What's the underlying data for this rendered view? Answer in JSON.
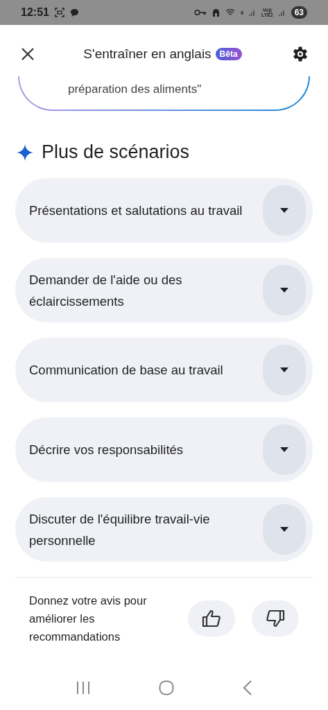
{
  "status_bar": {
    "time": "12:51",
    "wifi_label": "6",
    "volte_label": "Vo))",
    "network_label": "LTE2",
    "battery": "63"
  },
  "header": {
    "title": "S'entraîner en anglais",
    "badge": "Bêta"
  },
  "scenario_card": {
    "text": "préparation des aliments\""
  },
  "section": {
    "title": "Plus de scénarios"
  },
  "scenarios": [
    {
      "label": "Présentations et salutations au travail",
      "expanded": false
    },
    {
      "label": "Demander de l'aide ou des éclaircissements",
      "expanded": false
    },
    {
      "label": "Communication de base au travail",
      "expanded": false
    },
    {
      "label": "Décrire vos responsabilités",
      "expanded": false
    },
    {
      "label": "Discuter de l'équilibre travail-vie personnelle",
      "expanded": false
    }
  ],
  "feedback": {
    "text": "Donnez votre avis pour améliorer les recommandations"
  }
}
